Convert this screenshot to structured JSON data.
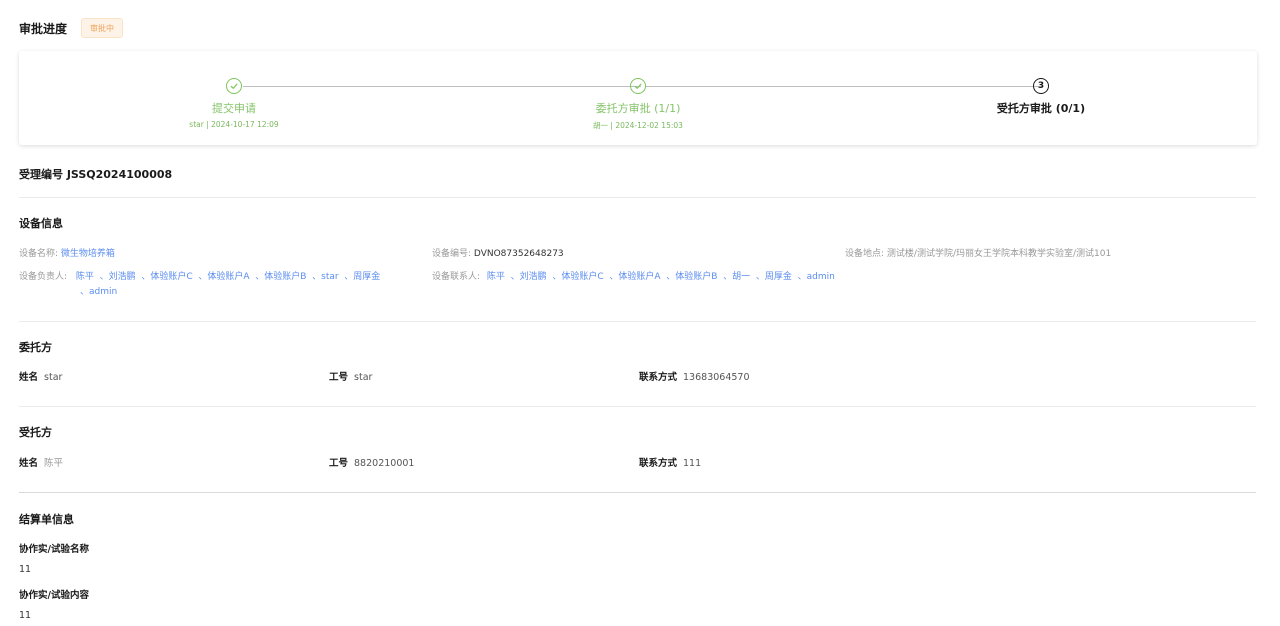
{
  "header": {
    "title": "审批进度",
    "status_badge": "审批中"
  },
  "steps": [
    {
      "title": "提交申请",
      "sub": "star | 2024-10-17 12:09",
      "state": "done"
    },
    {
      "title": "委托方审批 (1/1)",
      "sub": "胡一 | 2024-12-02 15:03",
      "state": "done"
    },
    {
      "title": "受托方审批 (0/1)",
      "sub": "",
      "number": "3",
      "state": "current"
    }
  ],
  "accept_no": "受理编号 JSSQ2024100008",
  "device": {
    "section_title": "设备信息",
    "name_label": "设备名称:",
    "name_value": "微生物培养箱",
    "code_label": "设备编号:",
    "code_value": "DVNO87352648273",
    "location_label": "设备地点:",
    "location_value": "测试楼/测试学院/玛丽女王学院本科教学实验室/测试101",
    "owners_label": "设备负责人:",
    "owners_line1": "陈平  、刘浩鹏  、体验账户C  、体验账户A  、体验账户B  、star  、周厚金",
    "owners_line2": "、admin",
    "contacts_label": "设备联系人:",
    "contacts_line": "陈平  、刘浩鹏  、体验账户C  、体验账户A  、体验账户B  、胡一  、周厚金  、admin"
  },
  "client": {
    "section_title": "委托方",
    "name_label": "姓名",
    "name_value": "star",
    "id_label": "工号",
    "id_value": "star",
    "contact_label": "联系方式",
    "contact_value": "13683064570"
  },
  "trustee": {
    "section_title": "受托方",
    "name_label": "姓名",
    "name_value": "陈平",
    "id_label": "工号",
    "id_value": "8820210001",
    "contact_label": "联系方式",
    "contact_value": "111"
  },
  "settlement": {
    "section_title": "结算单信息",
    "name_label": "协作实/试验名称",
    "name_value": "11",
    "content_label": "协作实/试验内容",
    "content_value": "11"
  },
  "colors": {
    "success": "#7bc45a",
    "link": "#5b8def",
    "badge_text": "#f0a35a",
    "badge_bg": "#fdf3e8"
  }
}
